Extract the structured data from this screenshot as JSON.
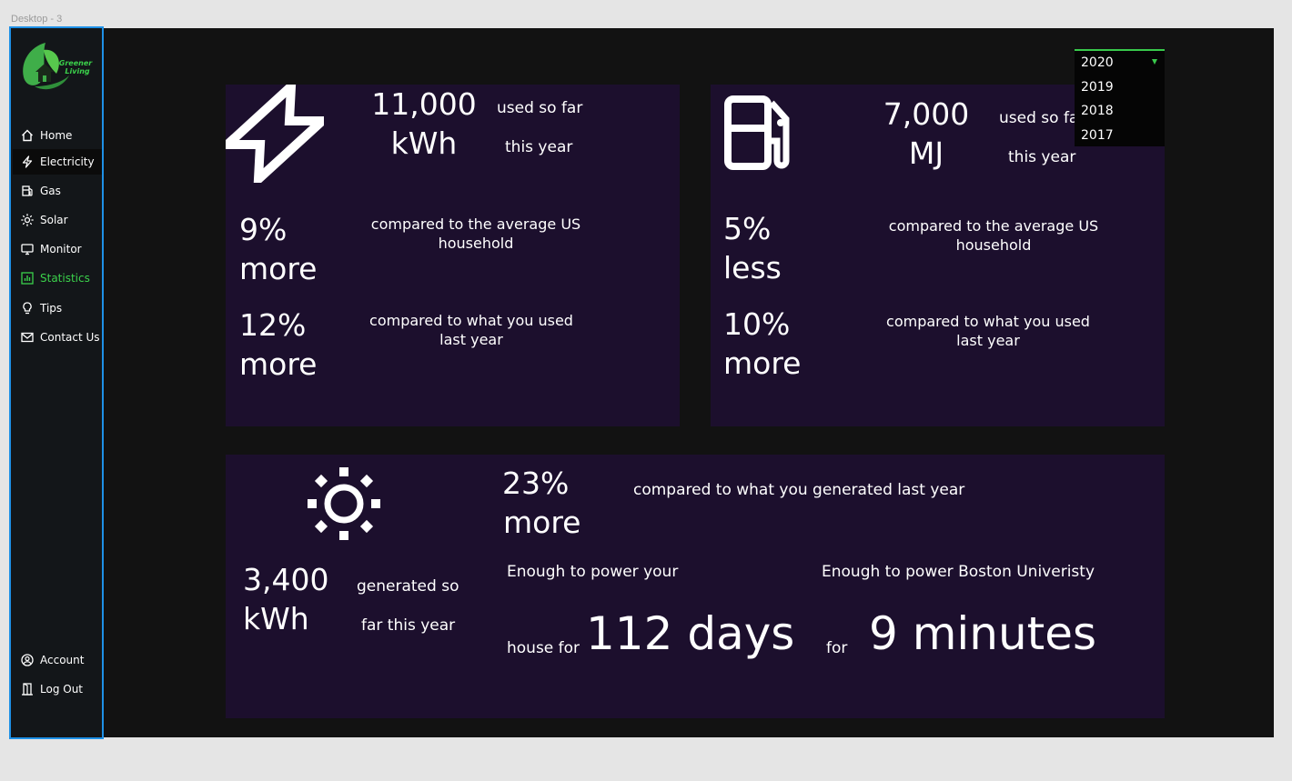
{
  "frame_label": "Desktop - 3",
  "brand": {
    "name": "Greener Living",
    "line1": "Greener",
    "line2": "Living"
  },
  "colors": {
    "accent": "#3bd14b",
    "card_bg": "#1c0f2d",
    "frame_bg": "#121212",
    "sidebar_bg": "#131619",
    "selection": "#1e90e6"
  },
  "nav": {
    "items": [
      {
        "label": "Home",
        "icon": "home-icon"
      },
      {
        "label": "Electricity",
        "icon": "lightning-icon"
      },
      {
        "label": "Gas",
        "icon": "gas-pump-icon"
      },
      {
        "label": "Solar",
        "icon": "sun-icon"
      },
      {
        "label": "Monitor",
        "icon": "monitor-icon"
      },
      {
        "label": "Statistics",
        "icon": "bar-chart-icon"
      },
      {
        "label": "Tips",
        "icon": "lightbulb-icon"
      },
      {
        "label": "Contact Us",
        "icon": "mail-icon"
      }
    ],
    "bottom": [
      {
        "label": "Account",
        "icon": "account-icon"
      },
      {
        "label": "Log Out",
        "icon": "logout-icon"
      }
    ],
    "active": "Statistics",
    "selected": "Electricity"
  },
  "year_dropdown": {
    "selected": "2020",
    "options": [
      "2020",
      "2019",
      "2018",
      "2017"
    ]
  },
  "electricity": {
    "amount": "11,000",
    "unit": "kWh",
    "used_line1": "used so far",
    "used_line2": "this year",
    "avg_pct": "9%",
    "avg_dir": "more",
    "avg_text_line1": "compared to the average US",
    "avg_text_line2": "household",
    "last_pct": "12%",
    "last_dir": "more",
    "last_text_line1": "compared to what you used",
    "last_text_line2": "last year"
  },
  "gas": {
    "amount": "7,000",
    "unit": "MJ",
    "used_line1": "used so fa",
    "used_line2": "this year",
    "avg_pct": "5%",
    "avg_dir": "less",
    "avg_text_line1": "compared to the average US",
    "avg_text_line2": "household",
    "last_pct": "10%",
    "last_dir": "more",
    "last_text_line1": "compared to what you used",
    "last_text_line2": "last year"
  },
  "solar": {
    "amount": "3,400",
    "unit": "kWh",
    "gen_line1": "generated so",
    "gen_line2": "far this year",
    "pct": "23%",
    "dir": "more",
    "compare_text": "compared to what you generated last year",
    "house_intro": "Enough to power your",
    "house_prefix": "house for",
    "house_value": "112 days",
    "bu_intro": "Enough to power Boston Univeristy",
    "bu_prefix": "for",
    "bu_value": "9 minutes"
  }
}
